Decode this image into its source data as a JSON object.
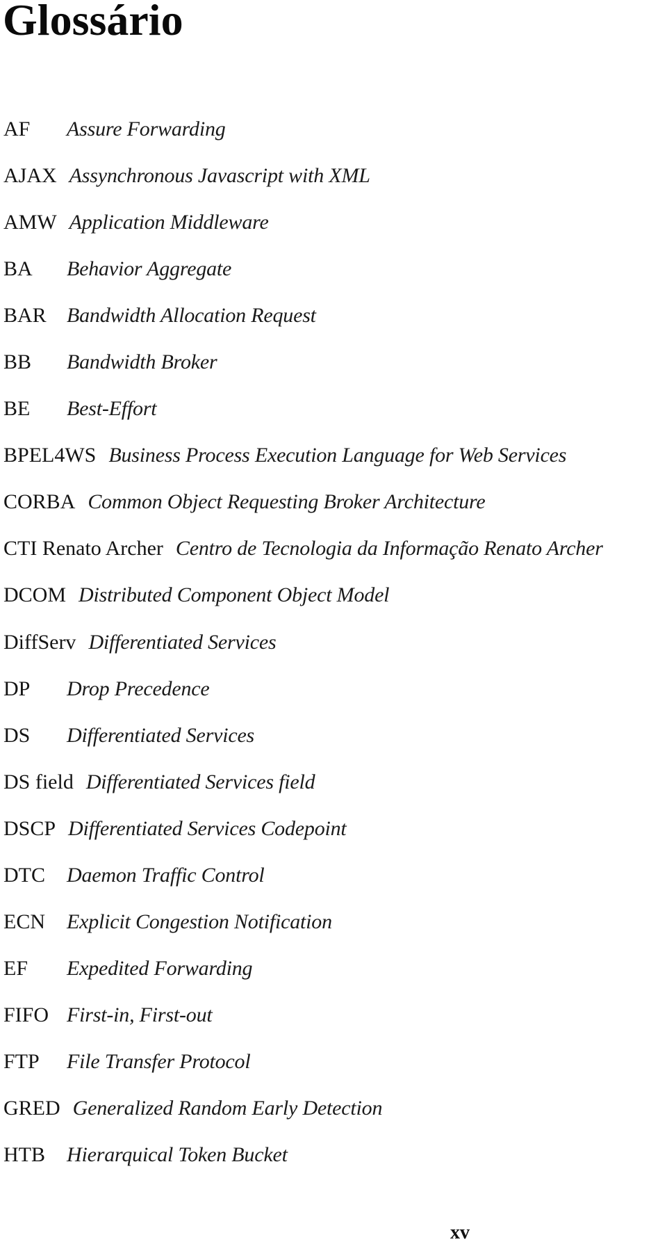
{
  "page": {
    "title": "Glossário",
    "page_number": "xv"
  },
  "glossary": {
    "entries": [
      {
        "term": "AF",
        "definition": "Assure Forwarding"
      },
      {
        "term": "AJAX",
        "definition": "Assynchronous Javascript with XML"
      },
      {
        "term": "AMW",
        "definition": "Application Middleware"
      },
      {
        "term": "BA",
        "definition": "Behavior Aggregate"
      },
      {
        "term": "BAR",
        "definition": "Bandwidth Allocation Request"
      },
      {
        "term": "BB",
        "definition": "Bandwidth Broker"
      },
      {
        "term": "BE",
        "definition": "Best-Effort"
      },
      {
        "term": "BPEL4WS",
        "definition": "Business Process Execution Language for Web Services"
      },
      {
        "term": "CORBA",
        "definition": "Common Object Requesting Broker Architecture"
      },
      {
        "term": "CTI Renato Archer",
        "definition": "Centro de Tecnologia da Informação Renato Archer"
      },
      {
        "term": "DCOM",
        "definition": "Distributed Component Object Model"
      },
      {
        "term": "DiffServ",
        "definition": "Differentiated Services"
      },
      {
        "term": "DP",
        "definition": "Drop Precedence"
      },
      {
        "term": "DS",
        "definition": "Differentiated Services"
      },
      {
        "term": "DS field",
        "definition": "Differentiated Services field"
      },
      {
        "term": "DSCP",
        "definition": "Differentiated Services Codepoint"
      },
      {
        "term": "DTC",
        "definition": "Daemon Traffic Control"
      },
      {
        "term": "ECN",
        "definition": "Explicit Congestion Notification"
      },
      {
        "term": "EF",
        "definition": "Expedited Forwarding"
      },
      {
        "term": "FIFO",
        "definition": "First-in, First-out"
      },
      {
        "term": "FTP",
        "definition": "File Transfer Protocol"
      },
      {
        "term": "GRED",
        "definition": "Generalized Random Early Detection"
      },
      {
        "term": "HTB",
        "definition": "Hierarquical Token Bucket"
      }
    ]
  }
}
